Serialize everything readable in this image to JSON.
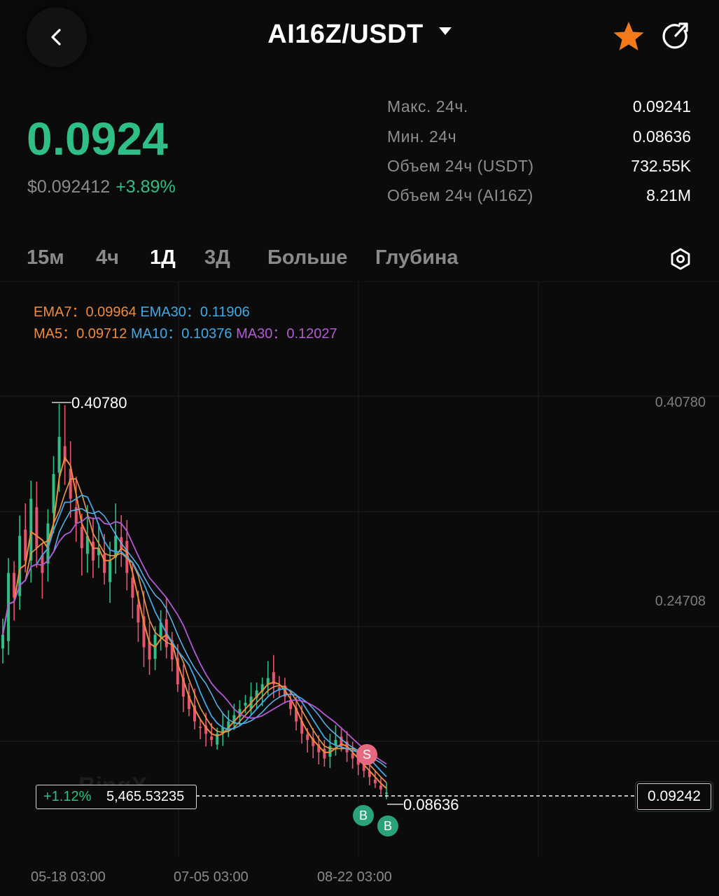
{
  "header": {
    "back_icon": "chevron-left-icon",
    "pair": "AI16Z/USDT",
    "favorite_icon": "star-icon",
    "favorite_color": "#f27a1a",
    "share_icon": "share-icon"
  },
  "price": {
    "last": "0.0924",
    "usd": "$0.092412",
    "change": "+3.89%",
    "up_color": "#2fbf86"
  },
  "stats": [
    {
      "label": "Макс. 24ч.",
      "value": "0.09241"
    },
    {
      "label": "Мин. 24ч",
      "value": "0.08636"
    },
    {
      "label": "Объем 24ч (USDT)",
      "value": "732.55K"
    },
    {
      "label": "Объем 24ч (AI16Z)",
      "value": "8.21M"
    }
  ],
  "tabs": [
    {
      "label": "15м",
      "active": false
    },
    {
      "label": "4ч",
      "active": false
    },
    {
      "label": "1Д",
      "active": true
    },
    {
      "label": "3Д",
      "active": false
    },
    {
      "label": "Больше",
      "active": false
    },
    {
      "label": "Глубина",
      "active": false
    }
  ],
  "settings_icon": "hexagon-gear-icon",
  "indicators": {
    "ema7_label": "EMA7：",
    "ema7_value": "0.09964",
    "ema30_label": "EMA30：",
    "ema30_value": "0.11906",
    "ma5_label": "MA5：",
    "ma5_value": "0.09712",
    "ma10_label": "MA10：",
    "ma10_value": "0.10376",
    "ma30_label": "MA30：",
    "ma30_value": "0.12027"
  },
  "chart_data": {
    "type": "candlestick",
    "interval": "1Д",
    "y_tick_labels": [
      "0.40780",
      "0.24708"
    ],
    "x_tick_labels": [
      "05-18 03:00",
      "07-05 03:00",
      "08-22 03:00"
    ],
    "high_label": "0.40780",
    "low_label": "0.08636",
    "current_price": "0.09242",
    "info_pct": "+1.12%",
    "info_value": "5,465.53235",
    "trade_markers": [
      {
        "type": "S",
        "approx_price": 0.118
      },
      {
        "type": "B",
        "approx_price": 0.089
      },
      {
        "type": "B",
        "approx_price": 0.088
      }
    ],
    "series": [
      {
        "name": "EMA7",
        "color": "#f08a3c"
      },
      {
        "name": "EMA30",
        "color": "#41a9e6"
      },
      {
        "name": "MA5",
        "color": "#f08a3c"
      },
      {
        "name": "MA10",
        "color": "#41a9e6"
      },
      {
        "name": "MA30",
        "color": "#b35ad6"
      }
    ],
    "approx_closes": [
      0.22,
      0.27,
      0.25,
      0.3,
      0.28,
      0.33,
      0.29,
      0.27,
      0.31,
      0.35,
      0.38,
      0.36,
      0.33,
      0.31,
      0.29,
      0.3,
      0.28,
      0.29,
      0.27,
      0.28,
      0.3,
      0.29,
      0.27,
      0.25,
      0.23,
      0.21,
      0.2,
      0.22,
      0.23,
      0.21,
      0.2,
      0.18,
      0.17,
      0.16,
      0.15,
      0.145,
      0.14,
      0.135,
      0.14,
      0.145,
      0.15,
      0.155,
      0.16,
      0.165,
      0.17,
      0.175,
      0.18,
      0.185,
      0.18,
      0.175,
      0.17,
      0.16,
      0.15,
      0.14,
      0.135,
      0.13,
      0.125,
      0.12,
      0.13,
      0.135,
      0.13,
      0.125,
      0.12,
      0.115,
      0.11,
      0.105,
      0.1,
      0.095,
      0.0924
    ],
    "colors": {
      "up": "#2fbf86",
      "down": "#e5556e"
    }
  }
}
